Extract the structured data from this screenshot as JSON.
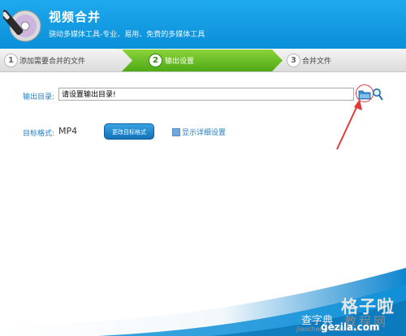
{
  "app": {
    "title": "视频合并",
    "subtitle": "骁动多媒体工具-专业、易用、免费的多媒体工具"
  },
  "steps": [
    {
      "number": "1",
      "label": "添加需要合并的文件",
      "active": false
    },
    {
      "number": "2",
      "label": "输出设置",
      "active": true
    },
    {
      "number": "3",
      "label": "合并文件",
      "active": false
    }
  ],
  "output": {
    "label": "输出目录:",
    "placeholder": "请设置输出目录!"
  },
  "format": {
    "label": "目标格式:",
    "value": "MP4",
    "change_button": "更改目标格式",
    "detail_label": "显示详细设置",
    "detail_checked": false
  },
  "icons": {
    "logo": "disc-pen-logo-icon",
    "folder": "folder-icon",
    "search": "magnifier-icon"
  },
  "watermark": {
    "line1": "格子啦",
    "line2": "教程网",
    "line3": "查字典",
    "line4": "jiaocheng.chazidian.com",
    "line5": "gezila.com"
  },
  "colors": {
    "header": "#1a9fe8",
    "active_step": "#58b11c",
    "label_blue": "#1b7fc4",
    "annotation_red": "#e03a3a"
  }
}
